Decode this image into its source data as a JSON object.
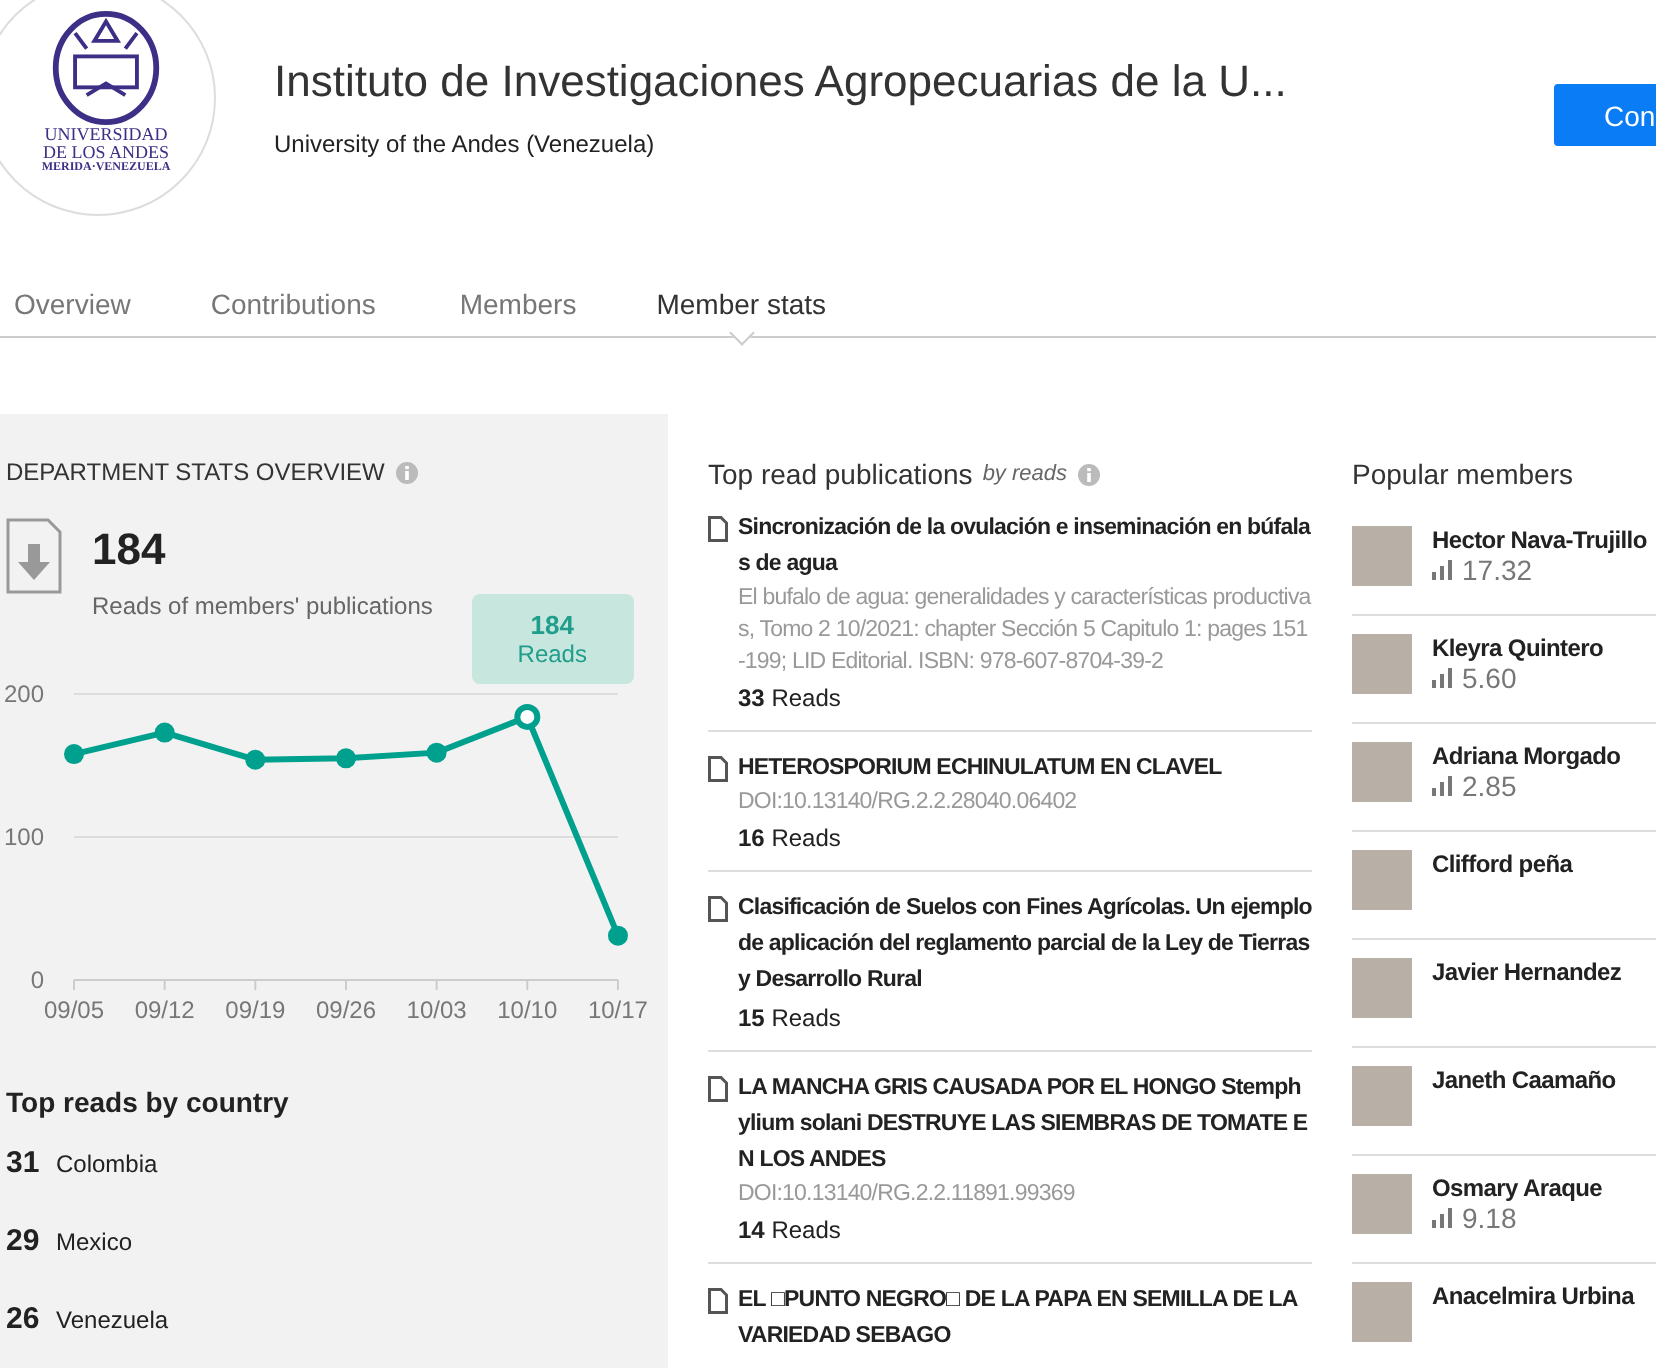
{
  "header": {
    "logo_text": [
      "UNIVERSIDAD",
      "DE LOS ANDES",
      "MERIDA·VENEZUELA"
    ],
    "title": "Instituto de Investigaciones Agropecuarias de la U...",
    "subtitle": "University of the Andes (Venezuela)",
    "button": "Con"
  },
  "tabs": [
    {
      "label": "Overview",
      "selected": false
    },
    {
      "label": "Contributions",
      "selected": false
    },
    {
      "label": "Members",
      "selected": false
    },
    {
      "label": "Member stats",
      "selected": true
    }
  ],
  "stats": {
    "heading": "DEPARTMENT STATS OVERVIEW",
    "total": "184",
    "total_label": "Reads of members' publications",
    "tooltip": {
      "value": "184"
    },
    "chart_data": {
      "type": "line",
      "categories": [
        "09/05",
        "09/12",
        "09/19",
        "09/26",
        "10/03",
        "10/10",
        "10/17"
      ],
      "series": [
        {
          "name": "Reads",
          "color": "#00a08e",
          "values": [
            158,
            173,
            154,
            155,
            159,
            184,
            31
          ],
          "marker": true
        }
      ],
      "ylim": [
        0,
        200
      ],
      "yticks": [
        0,
        100,
        200
      ]
    },
    "countries_heading": "Top reads by country",
    "countries": [
      {
        "count": "31",
        "name": "Colombia"
      },
      {
        "count": "29",
        "name": "Mexico"
      },
      {
        "count": "26",
        "name": "Venezuela"
      }
    ]
  },
  "publications": {
    "heading": "Top read publications",
    "heading_note": "by reads",
    "items": [
      {
        "title": "Sincronización de la ovulación e inseminación en búfalas de agua",
        "meta": "El bufalo de agua: generalidades y características productivas, Tomo 2 10/2021: chapter Sección 5 Capitulo 1: pages 151-199; LID Editorial. ISBN: 978-607-8704-39-2",
        "reads": "33",
        "reads_label": "Reads"
      },
      {
        "title": "HETEROSPORIUM ECHINULATUM EN CLAVEL",
        "meta": "DOI:10.13140/RG.2.2.28040.06402",
        "reads": "16",
        "reads_label": "Reads"
      },
      {
        "title": "Clasificación de Suelos con Fines Agrícolas. Un ejemplo de aplicación del reglamento parcial de la Ley de Tierras y Desarrollo Rural",
        "reads": "15",
        "reads_label": "Reads"
      },
      {
        "title": "LA MANCHA GRIS CAUSADA POR EL HONGO Stemphylium solani DESTRUYE LAS SIEMBRAS DE TOMATE EN LOS ANDES",
        "meta": "DOI:10.13140/RG.2.2.11891.99369",
        "reads": "14",
        "reads_label": "Reads"
      },
      {
        "title": "EL □PUNTO NEGRO□ DE LA PAPA EN SEMILLA DE LA VARIEDAD SEBAGO"
      }
    ]
  },
  "members": {
    "heading": "Popular members",
    "items": [
      {
        "name": "Hector Nava-Trujillo",
        "score": "17.32"
      },
      {
        "name": "Kleyra Quintero",
        "score": "5.60"
      },
      {
        "name": "Adriana Morgado",
        "score": "2.85"
      },
      {
        "name": "Clifford peña"
      },
      {
        "name": "Javier Hernandez"
      },
      {
        "name": "Janeth Caamaño"
      },
      {
        "name": "Osmary Araque",
        "score": "9.18"
      },
      {
        "name": "Anacelmira Urbina"
      }
    ]
  }
}
